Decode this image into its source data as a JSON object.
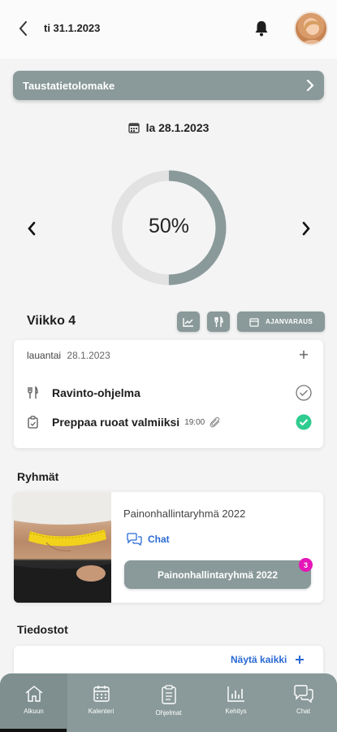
{
  "header": {
    "date": "ti 31.1.2023",
    "back_icon": "chevron-left-icon",
    "bell_icon": "bell-icon"
  },
  "banner": {
    "label": "Taustatietolomake"
  },
  "day_nav": {
    "date": "la 28.1.2023",
    "progress_text": "50%",
    "progress": 0.5
  },
  "week": {
    "label": "Viikko 4",
    "booking_label": "AJANVARAUS"
  },
  "day_card": {
    "weekday": "lauantai",
    "date": "28.1.2023",
    "tasks": [
      {
        "label": "Ravinto-ohjelma",
        "time": "",
        "done": false
      },
      {
        "label": "Preppaa ruoat valmiiksi",
        "time": "19:00",
        "done": true
      }
    ]
  },
  "groups": {
    "title": "Ryhmät",
    "group_name": "Painonhallintaryhmä 2022",
    "chat_label": "Chat",
    "button_label": "Painonhallintaryhmä 2022",
    "badge_count": "3"
  },
  "files": {
    "title": "Tiedostot",
    "show_all_label": "Näytä kaikki"
  },
  "nav": {
    "items": [
      {
        "label": "Alkuun",
        "icon": "home-icon"
      },
      {
        "label": "Kalenteri",
        "icon": "calendar-icon"
      },
      {
        "label": "Ohjelmat",
        "icon": "clipboard-icon"
      },
      {
        "label": "Kehitys",
        "icon": "chart-icon"
      },
      {
        "label": "Chat",
        "icon": "chat-icon"
      }
    ]
  },
  "colors": {
    "accent": "#8a9999",
    "link": "#2a6ad4",
    "success": "#2ecc8f",
    "badge": "#e516b8"
  }
}
